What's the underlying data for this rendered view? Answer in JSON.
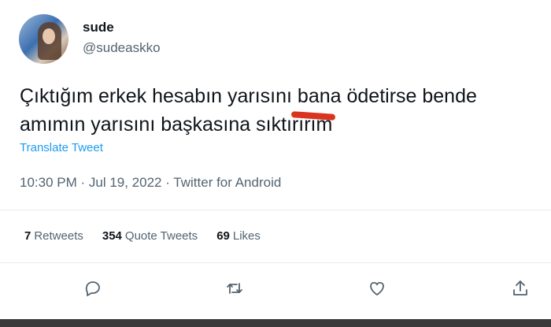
{
  "author": {
    "display_name": "sude",
    "handle": "@sudeaskko"
  },
  "tweet": {
    "text_line1": "Çıktığım erkek hesabın yarısını bana ödetirse bende",
    "text_line2": "amımın yarısını başkasına sıktırırım",
    "translate_label": "Translate Tweet",
    "meta": "10:30 PM · Jul 19, 2022 · Twitter for Android"
  },
  "stats": {
    "retweets_count": "7",
    "retweets_label": "Retweets",
    "quotes_count": "354",
    "quotes_label": "Quote Tweets",
    "likes_count": "69",
    "likes_label": "Likes"
  },
  "colors": {
    "accent": "#1d9bf0",
    "secondary_text": "#536471",
    "primary_text": "#0f1419",
    "redaction_mark": "#d9341f"
  },
  "icons": [
    "reply-icon",
    "retweet-icon",
    "like-icon",
    "share-icon"
  ]
}
